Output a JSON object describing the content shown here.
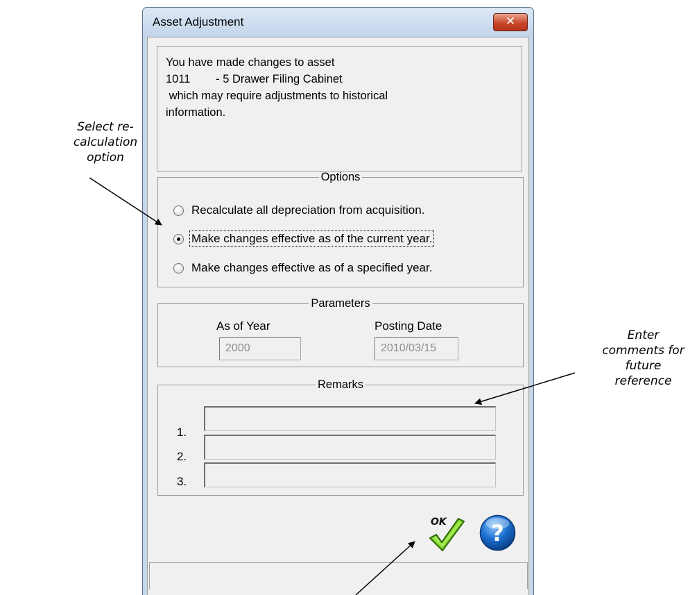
{
  "annotations": {
    "left": [
      "Select re-",
      "calculation",
      "option"
    ],
    "right": [
      "Enter",
      "comments for",
      "future",
      "reference"
    ]
  },
  "window": {
    "title": "Asset Adjustment",
    "close_glyph": "✕"
  },
  "message": {
    "lines": [
      "You have made changes to asset",
      "1011        - 5 Drawer Filing Cabinet",
      " which may require adjustments to historical",
      "information."
    ]
  },
  "options": {
    "legend": "Options",
    "items": [
      {
        "label": "Recalculate all depreciation from acquisition.",
        "checked": false
      },
      {
        "label": "Make changes effective as of the current year.",
        "checked": true
      },
      {
        "label": "Make changes effective as of a specified year.",
        "checked": false
      }
    ]
  },
  "parameters": {
    "legend": "Parameters",
    "as_of_year_label": "As of Year",
    "as_of_year_value": "2000",
    "posting_date_label": "Posting Date",
    "posting_date_value": "2010/03/15"
  },
  "remarks": {
    "legend": "Remarks",
    "rows": [
      {
        "num": "1.",
        "value": ""
      },
      {
        "num": "2.",
        "value": ""
      },
      {
        "num": "3.",
        "value": ""
      }
    ]
  },
  "buttons": {
    "ok_text": "OK",
    "help_text": "?",
    "ok_icon": "ok-checkmark-icon",
    "help_icon": "help-question-icon"
  },
  "colors": {
    "window_frame": "#c7d6e8",
    "close_button": "#c9472d",
    "help_blue": "#1a6fd0",
    "ok_green": "#6cc21e"
  }
}
